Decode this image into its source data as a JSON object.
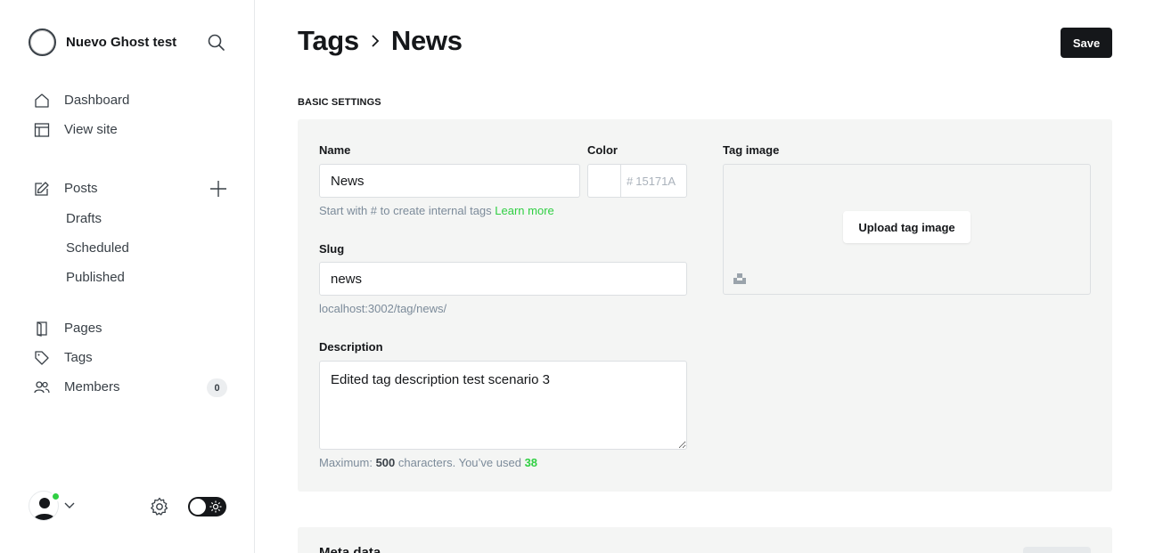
{
  "sidebar": {
    "brand_name": "Nuevo Ghost test",
    "nav": {
      "dashboard": "Dashboard",
      "view_site": "View site",
      "posts": "Posts",
      "drafts": "Drafts",
      "scheduled": "Scheduled",
      "published": "Published",
      "pages": "Pages",
      "tags": "Tags",
      "members": "Members"
    },
    "members_count": "0",
    "user_status_color": "#30cf43",
    "icons": [
      "search-icon",
      "home-icon",
      "view-site-icon",
      "edit-icon",
      "plus-icon",
      "pages-icon",
      "tag-icon",
      "members-icon",
      "avatar-icon",
      "chevron-down-icon",
      "gear-icon",
      "sun-icon"
    ]
  },
  "header": {
    "breadcrumb_parent": "Tags",
    "breadcrumb_current": "News",
    "save_label": "Save"
  },
  "basic_settings": {
    "section_title": "BASIC SETTINGS",
    "name_label": "Name",
    "name_value": "News",
    "name_hint": "Start with # to create internal tags",
    "name_hint_link": "Learn more",
    "color_label": "Color",
    "color_hash": "#",
    "color_value": "15171A",
    "slug_label": "Slug",
    "slug_value": "news",
    "slug_url": "localhost:3002/tag/news/",
    "description_label": "Description",
    "description_value": "Edited tag description test scenario 3",
    "description_hint_prefix": "Maximum:",
    "description_max": "500",
    "description_hint_middle": "characters. You’ve used",
    "description_used": "38",
    "tag_image_label": "Tag image",
    "upload_label": "Upload tag image"
  },
  "meta_data": {
    "title": "Meta data"
  },
  "colors": {
    "accent": "#30cf43",
    "primary": "#15171a",
    "panel_bg": "#f4f5f4"
  }
}
